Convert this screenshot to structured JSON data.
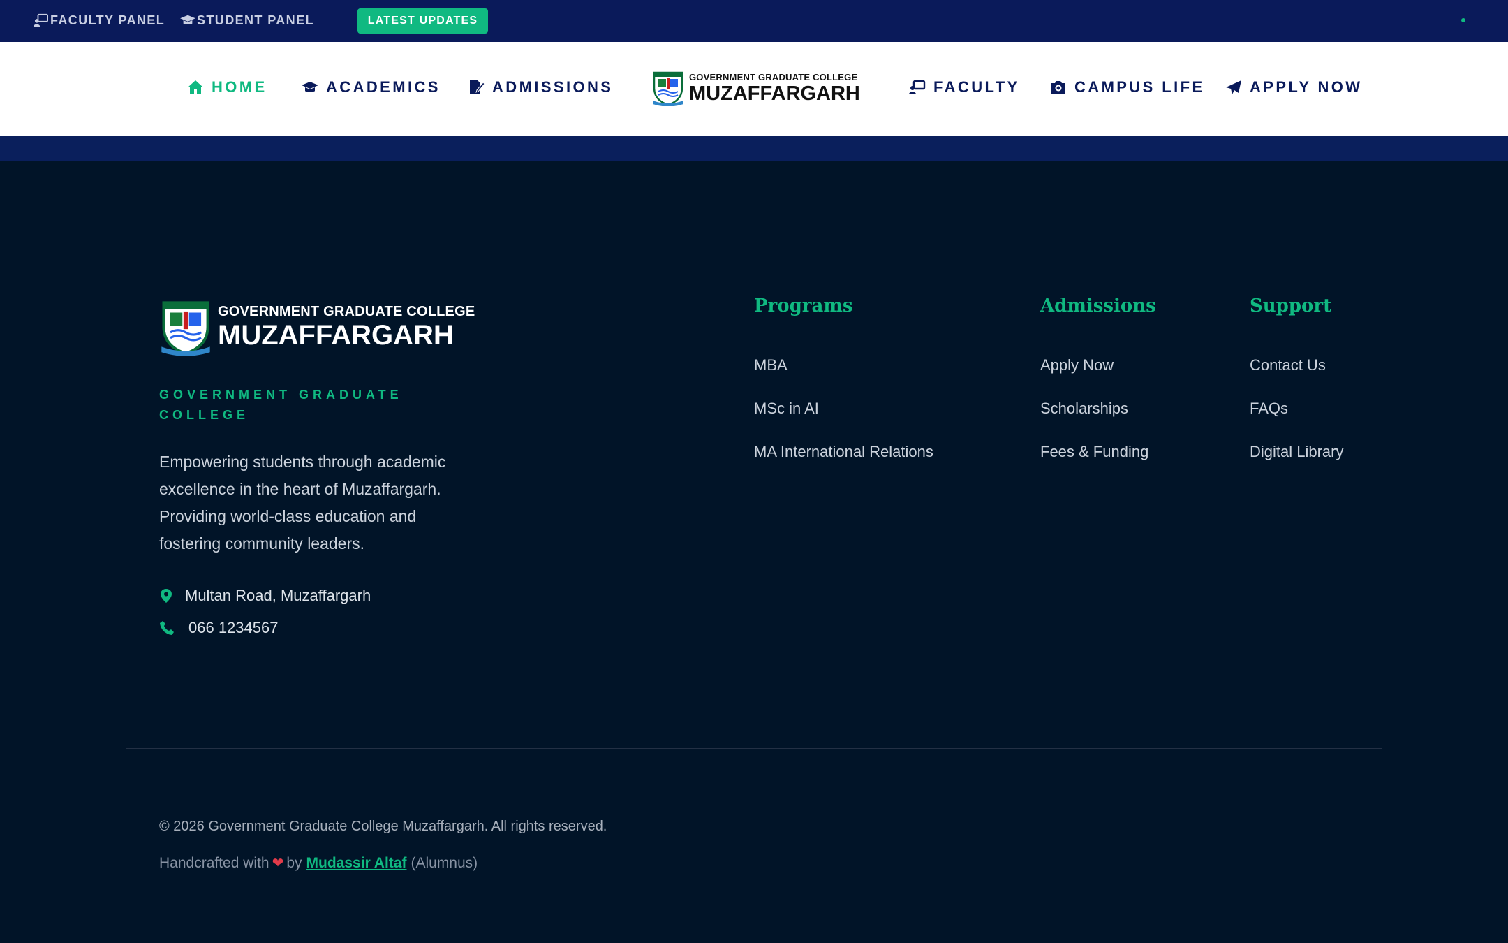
{
  "topbar": {
    "faculty_panel": "FACULTY PANEL",
    "student_panel": "STUDENT PANEL",
    "latest_updates": "LATEST UPDATES"
  },
  "nav": {
    "home": "HOME",
    "academics": "ACADEMICS",
    "admissions": "ADMISSIONS",
    "faculty": "FACULTY",
    "campus_life": "CAMPUS LIFE",
    "apply_now": "APPLY NOW",
    "logo_small": "GOVERNMENT GRADUATE COLLEGE",
    "logo_big": "MUZAFFARGARH"
  },
  "footer": {
    "logo_small": "GOVERNMENT GRADUATE COLLEGE",
    "logo_big": "MUZAFFARGARH",
    "tagline": "GOVERNMENT GRADUATE COLLEGE",
    "about": "Empowering students through academic excellence in the heart of Muzaffargarh. Providing world-class education and fostering community leaders.",
    "address": "Multan Road, Muzaffargarh",
    "phone": "066 1234567",
    "columns": [
      {
        "heading": "Programs",
        "links": [
          "MBA",
          "MSc in AI",
          "MA International Relations"
        ]
      },
      {
        "heading": "Admissions",
        "links": [
          "Apply Now",
          "Scholarships",
          "Fees & Funding"
        ]
      },
      {
        "heading": "Support",
        "links": [
          "Contact Us",
          "FAQs",
          "Digital Library"
        ]
      }
    ],
    "copyright": "© 2026 Government Graduate College Muzaffargarh. All rights reserved.",
    "credit_prefix": "Handcrafted with",
    "credit_by": "by",
    "credit_author": "Mudassir Altaf",
    "credit_suffix": "(Alumnus)"
  },
  "colors": {
    "accent": "#10b981",
    "navy": "#0a1a5a",
    "footer_bg": "#011428"
  }
}
